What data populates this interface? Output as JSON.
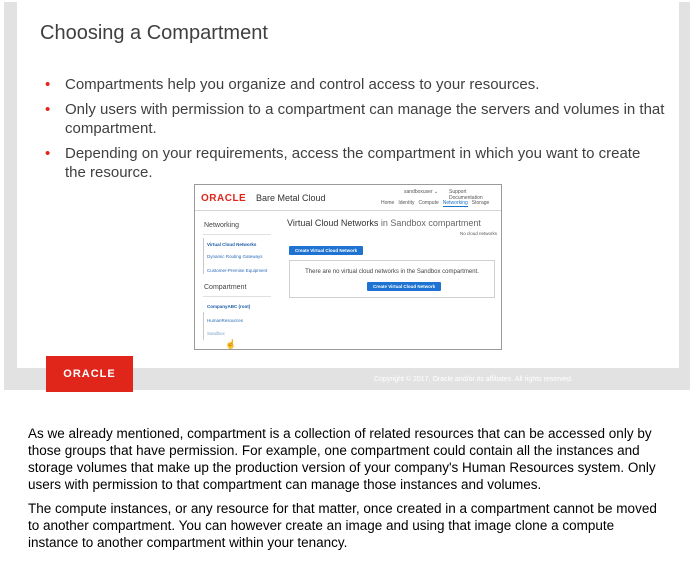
{
  "slide": {
    "title": "Choosing a Compartment",
    "bullets": [
      "Compartments help you organize and control access to your resources.",
      "Only users with permission to a compartment can manage the servers and volumes in that compartment.",
      "Depending on your requirements, access the compartment in which you want to create the resource."
    ],
    "bullet_color": "#e0261b",
    "footer": {
      "badge": "ORACLE",
      "copyright": "Copyright © 2017, Oracle and/or its affiliates. All rights reserved."
    }
  },
  "screenshot": {
    "logo": "ORACLE",
    "product": "Bare Metal Cloud",
    "user": "sandboxuser ⌄",
    "links": "Support  Documentation",
    "nav": [
      "Home",
      "Identity",
      "Compute",
      "Networking",
      "Storage"
    ],
    "nav_active": "Networking",
    "sidebar": {
      "networking_heading": "Networking",
      "networking_links": [
        "Virtual Cloud Networks",
        "Dynamic Routing Gateways",
        "Customer-Premise Equipment"
      ],
      "compartment_heading": "Compartment",
      "compartment_links": [
        "CompanyABC (root)",
        "HumanResources",
        "Sandbox"
      ]
    },
    "main": {
      "title_main": "Virtual Cloud Networks",
      "title_in": " in Sandbox compartment",
      "count": "No cloud networks",
      "create_button": "Create Virtual Cloud Network",
      "empty_text": "There are no virtual cloud networks in the Sandbox compartment.",
      "create_button_2": "Create Virtual Cloud Network"
    },
    "accent": "#1e73d2"
  },
  "notes": [
    "As we already mentioned, compartment is a collection of related resources that can be accessed only by those groups that have permission. For example, one compartment could contain all the instances and storage volumes that make up the production version of your company's Human Resources system. Only users with permission to that compartment can manage those instances and volumes.",
    "The compute instances, or any resource for that matter, once created in a compartment cannot be moved to another compartment. You can however create an image and using that image clone a compute instance to another compartment within your tenancy."
  ]
}
